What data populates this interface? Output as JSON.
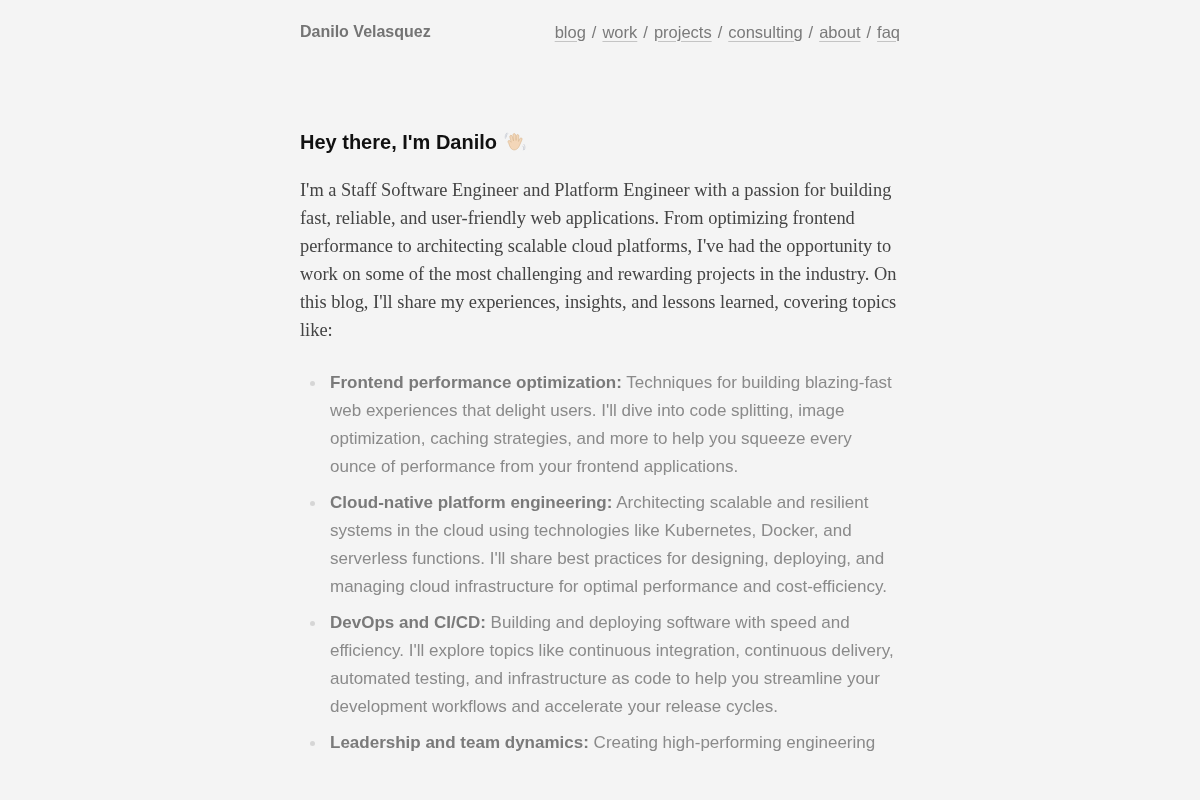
{
  "header": {
    "site_title": "Danilo Velasquez",
    "nav": [
      {
        "kind": "link",
        "label": "blog"
      },
      {
        "kind": "separator",
        "label": "/"
      },
      {
        "kind": "link",
        "label": "work"
      },
      {
        "kind": "separator",
        "label": "/"
      },
      {
        "kind": "link",
        "label": "projects"
      },
      {
        "kind": "separator",
        "label": "/"
      },
      {
        "kind": "link",
        "label": "consulting"
      },
      {
        "kind": "separator",
        "label": "/"
      },
      {
        "kind": "link",
        "label": "about"
      },
      {
        "kind": "separator",
        "label": "/"
      },
      {
        "kind": "link",
        "label": "faq"
      }
    ]
  },
  "intro": {
    "heading": "Hey there, I'm Danilo",
    "paragraph": "I'm a Staff Software Engineer and Platform Engineer with a passion for building fast, reliable, and user-friendly web applications. From optimizing frontend performance to architecting scalable cloud platforms, I've had the opportunity to work on some of the most challenging and rewarding projects in the industry. On this blog, I'll share my experiences, insights, and lessons learned, covering topics like:"
  },
  "topics": [
    "**Frontend performance optimization:** Techniques for building blazing-fast web experiences that delight users. I'll dive into code splitting, image optimization, caching strategies, and more to help you squeeze every ounce of performance from your frontend applications.",
    "**Cloud-native platform engineering:** Architecting scalable and resilient systems in the cloud using technologies like Kubernetes, Docker, and serverless functions. I'll share best practices for designing, deploying, and managing cloud infrastructure for optimal performance and cost-efficiency.",
    "**DevOps and CI/CD:** Building and deploying software with speed and efficiency. I'll explore topics like continuous integration, continuous delivery, automated testing, and infrastructure as code to help you streamline your development workflows and accelerate your release cycles.",
    "**Leadership and team dynamics:** Creating high-performing engineering"
  ]
}
